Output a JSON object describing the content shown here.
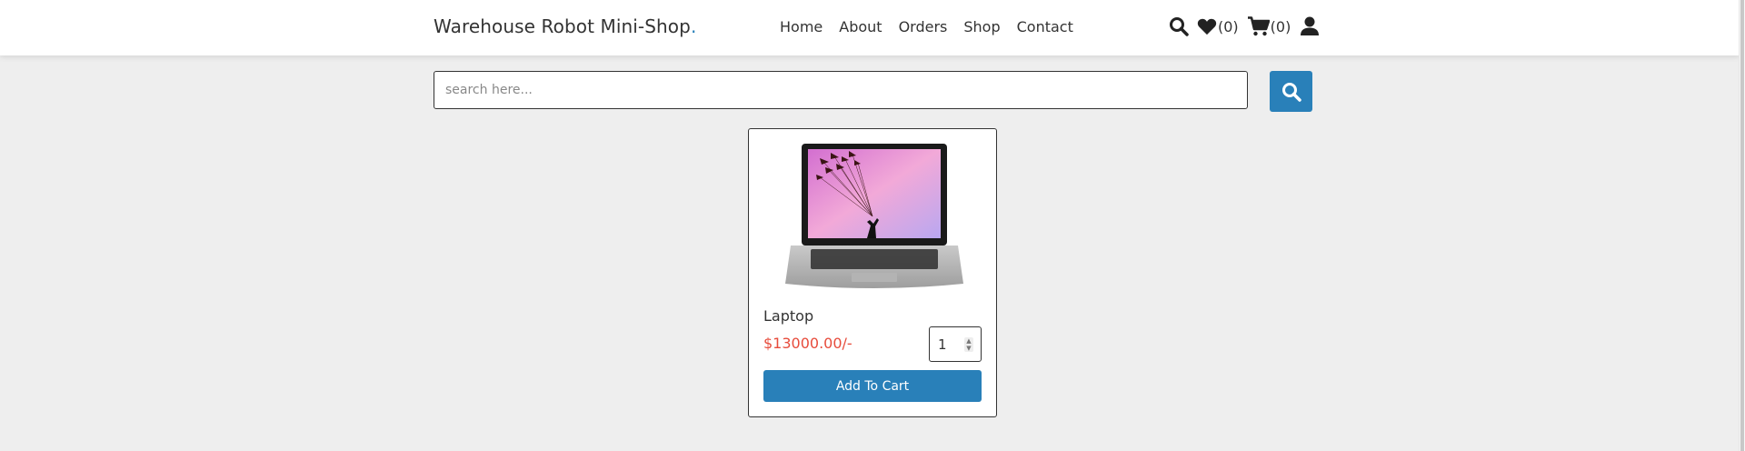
{
  "header": {
    "logo_text": "Warehouse Robot Mini-Shop",
    "logo_dot": ".",
    "nav": [
      "Home",
      "About",
      "Orders",
      "Shop",
      "Contact"
    ],
    "wishlist_count": "(0)",
    "cart_count": "(0)"
  },
  "search": {
    "placeholder": "search here..."
  },
  "product": {
    "name": "Laptop",
    "price": "$13000.00/-",
    "quantity": "1",
    "add_label": "Add To Cart"
  },
  "colors": {
    "accent": "#2980b9",
    "price": "#e74c3c",
    "background": "#eeeeee"
  }
}
